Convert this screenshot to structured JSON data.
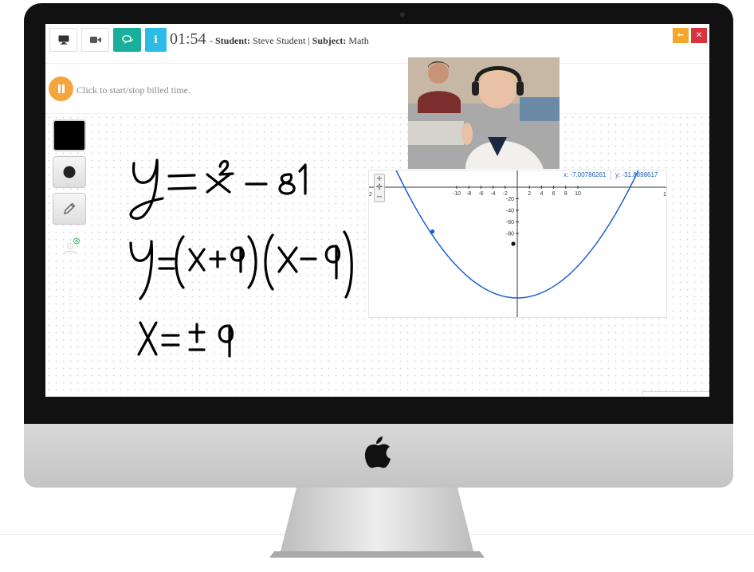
{
  "session": {
    "timer": "01:54",
    "separator_dash": "-",
    "student_label": "Student:",
    "student_name": "Steve Student",
    "divider": "|",
    "subject_label": "Subject:",
    "subject_name": "Math"
  },
  "toolbar": {
    "buttons": [
      {
        "icon": "monitor-icon",
        "style": "plain"
      },
      {
        "icon": "video-camera-icon",
        "style": "plain"
      },
      {
        "icon": "chat-bubbles-icon",
        "style": "teal"
      },
      {
        "icon": "info-icon",
        "style": "blue",
        "glyph": "i"
      }
    ],
    "minimize_glyph": "←",
    "close_glyph": "✕"
  },
  "billing": {
    "label": "Click to start/stop billed time.",
    "state": "paused"
  },
  "whiteboard": {
    "tools": [
      "color-swatch",
      "dot-tool",
      "pen-tool",
      "add-user"
    ],
    "selected_color": "#000000",
    "equations": [
      "y = x² − 81",
      "y = (x+9)(x−9)",
      "x = ± 9"
    ]
  },
  "graph": {
    "coord_x": "x: -7.00786261",
    "coord_y": "y: -31.8898617",
    "x_ticks": [
      "-10",
      "-8",
      "-6",
      "-4",
      "-2",
      "2",
      "4",
      "6",
      "8",
      "10"
    ],
    "y_ticks": [
      "-20",
      "-40",
      "-60",
      "-80"
    ],
    "left_edge_label": "2",
    "right_edge_label": "1",
    "curve_color": "#1a5fd1"
  },
  "colors": {
    "teal": "#18b09a",
    "blue": "#2bbbe4",
    "orange": "#f4a62a",
    "red": "#d9333f",
    "billing": "#f4a540"
  }
}
